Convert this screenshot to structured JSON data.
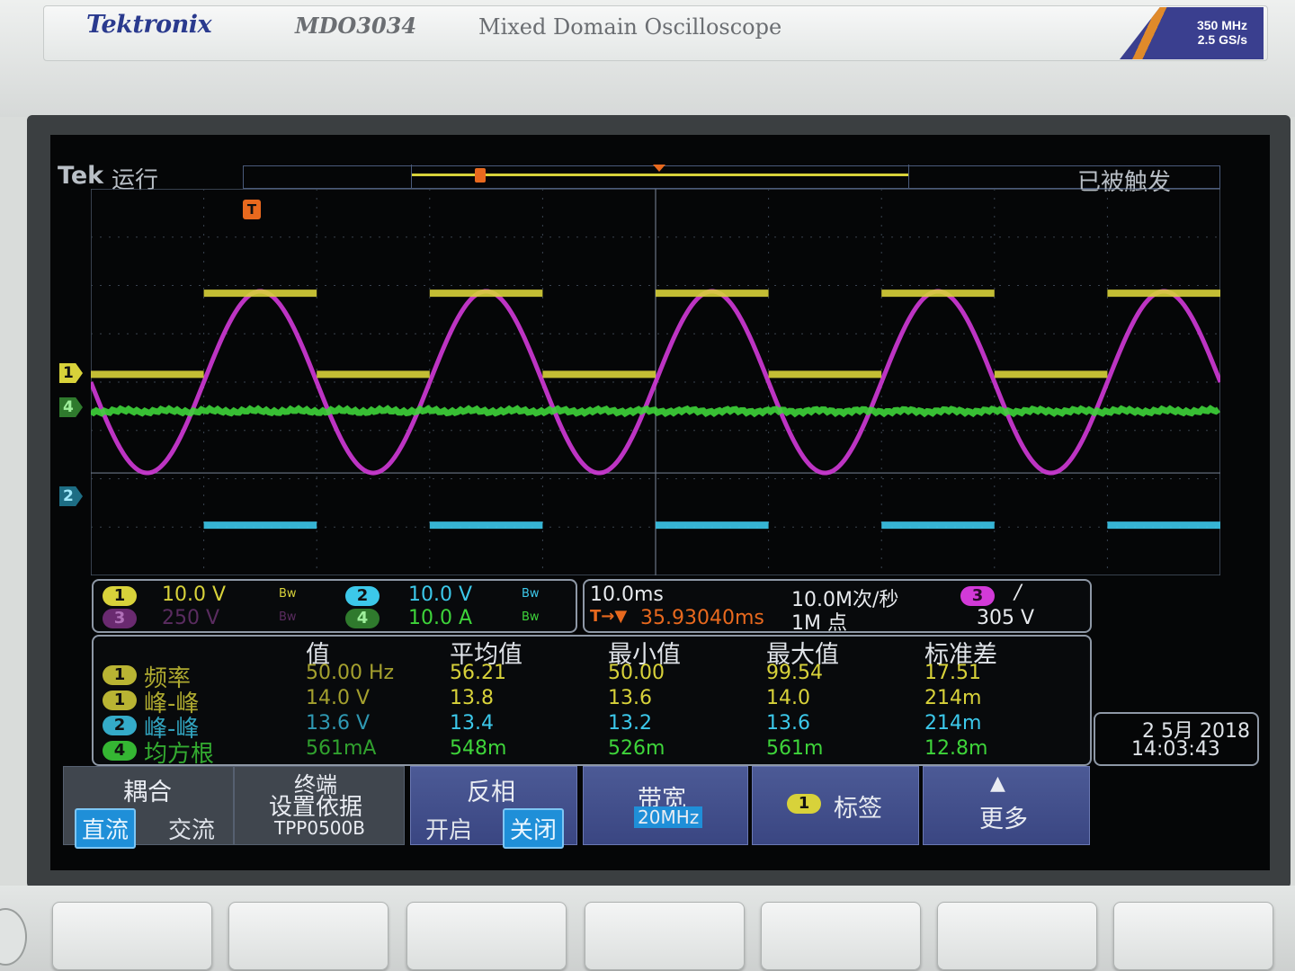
{
  "instrument": {
    "brand": "Tektronix",
    "model": "MDO3034",
    "description": "Mixed Domain Oscilloscope",
    "bandwidth": "350 MHz",
    "sample_rate": "2.5 GS/s"
  },
  "status": {
    "brand": "Tek",
    "run_state": "运行",
    "trigger_state": "已被触发",
    "trigger_marker": "T"
  },
  "channels": {
    "ch1": {
      "num": "1",
      "scale": "10.0 V",
      "bw": "Bw",
      "color": "#d8d23a"
    },
    "ch2": {
      "num": "2",
      "scale": "10.0 V",
      "bw": "Bw",
      "color": "#3cc8ea"
    },
    "ch3": {
      "num": "3",
      "scale": "250 V",
      "bw": "Bw",
      "color": "#d23ad8"
    },
    "ch4": {
      "num": "4",
      "scale": "10.0 A",
      "bw": "Bw",
      "color": "#3ed43a"
    }
  },
  "timebase": {
    "scale": "10.0ms",
    "trigger_position": "35.93040ms",
    "sample_rate": "10.0M次/秒",
    "record_length": "1M 点",
    "trigger_channel": "3",
    "trigger_slope": "/",
    "trigger_level": "305 V"
  },
  "measurements": {
    "headers": [
      "值",
      "平均值",
      "最小值",
      "最大值",
      "标准差"
    ],
    "rows": [
      {
        "ch": "1",
        "label": "频率",
        "value": "50.00 Hz",
        "mean": "56.21",
        "min": "50.00",
        "max": "99.54",
        "std": "17.51",
        "color": "#d8d23a"
      },
      {
        "ch": "1",
        "label": "峰-峰",
        "value": "14.0 V",
        "mean": "13.8",
        "min": "13.6",
        "max": "14.0",
        "std": "214m",
        "color": "#d8d23a"
      },
      {
        "ch": "2",
        "label": "峰-峰",
        "value": "13.6 V",
        "mean": "13.4",
        "min": "13.2",
        "max": "13.6",
        "std": "214m",
        "color": "#3cc8ea"
      },
      {
        "ch": "4",
        "label": "均方根",
        "value": "561mA",
        "mean": "548m",
        "min": "526m",
        "max": "561m",
        "std": "12.8m",
        "color": "#3ed43a"
      }
    ]
  },
  "datetime": {
    "date": "2 5月 2018",
    "time": "14:03:43"
  },
  "menu": {
    "coupling": {
      "title": "耦合",
      "opt1": "直流",
      "opt2": "交流"
    },
    "termination": {
      "line1": "终端",
      "line2": "设置依据",
      "line3": "TPP0500B"
    },
    "invert": {
      "title": "反相",
      "opt1": "开启",
      "opt2": "关闭"
    },
    "bandwidth": {
      "title": "带宽",
      "value": "20MHz"
    },
    "label": {
      "ch": "1",
      "title": "标签"
    },
    "more": {
      "title": "更多"
    }
  },
  "waveforms": {
    "ch1_square": {
      "period_divs": 2.0,
      "color": "#d8d23a"
    },
    "ch2_square": {
      "period_divs": 2.0,
      "color": "#3cc8ea"
    },
    "ch3_sine": {
      "period_divs": 2.0,
      "color": "#d23ad8"
    },
    "ch4_flat": {
      "color": "#3ed43a"
    }
  }
}
